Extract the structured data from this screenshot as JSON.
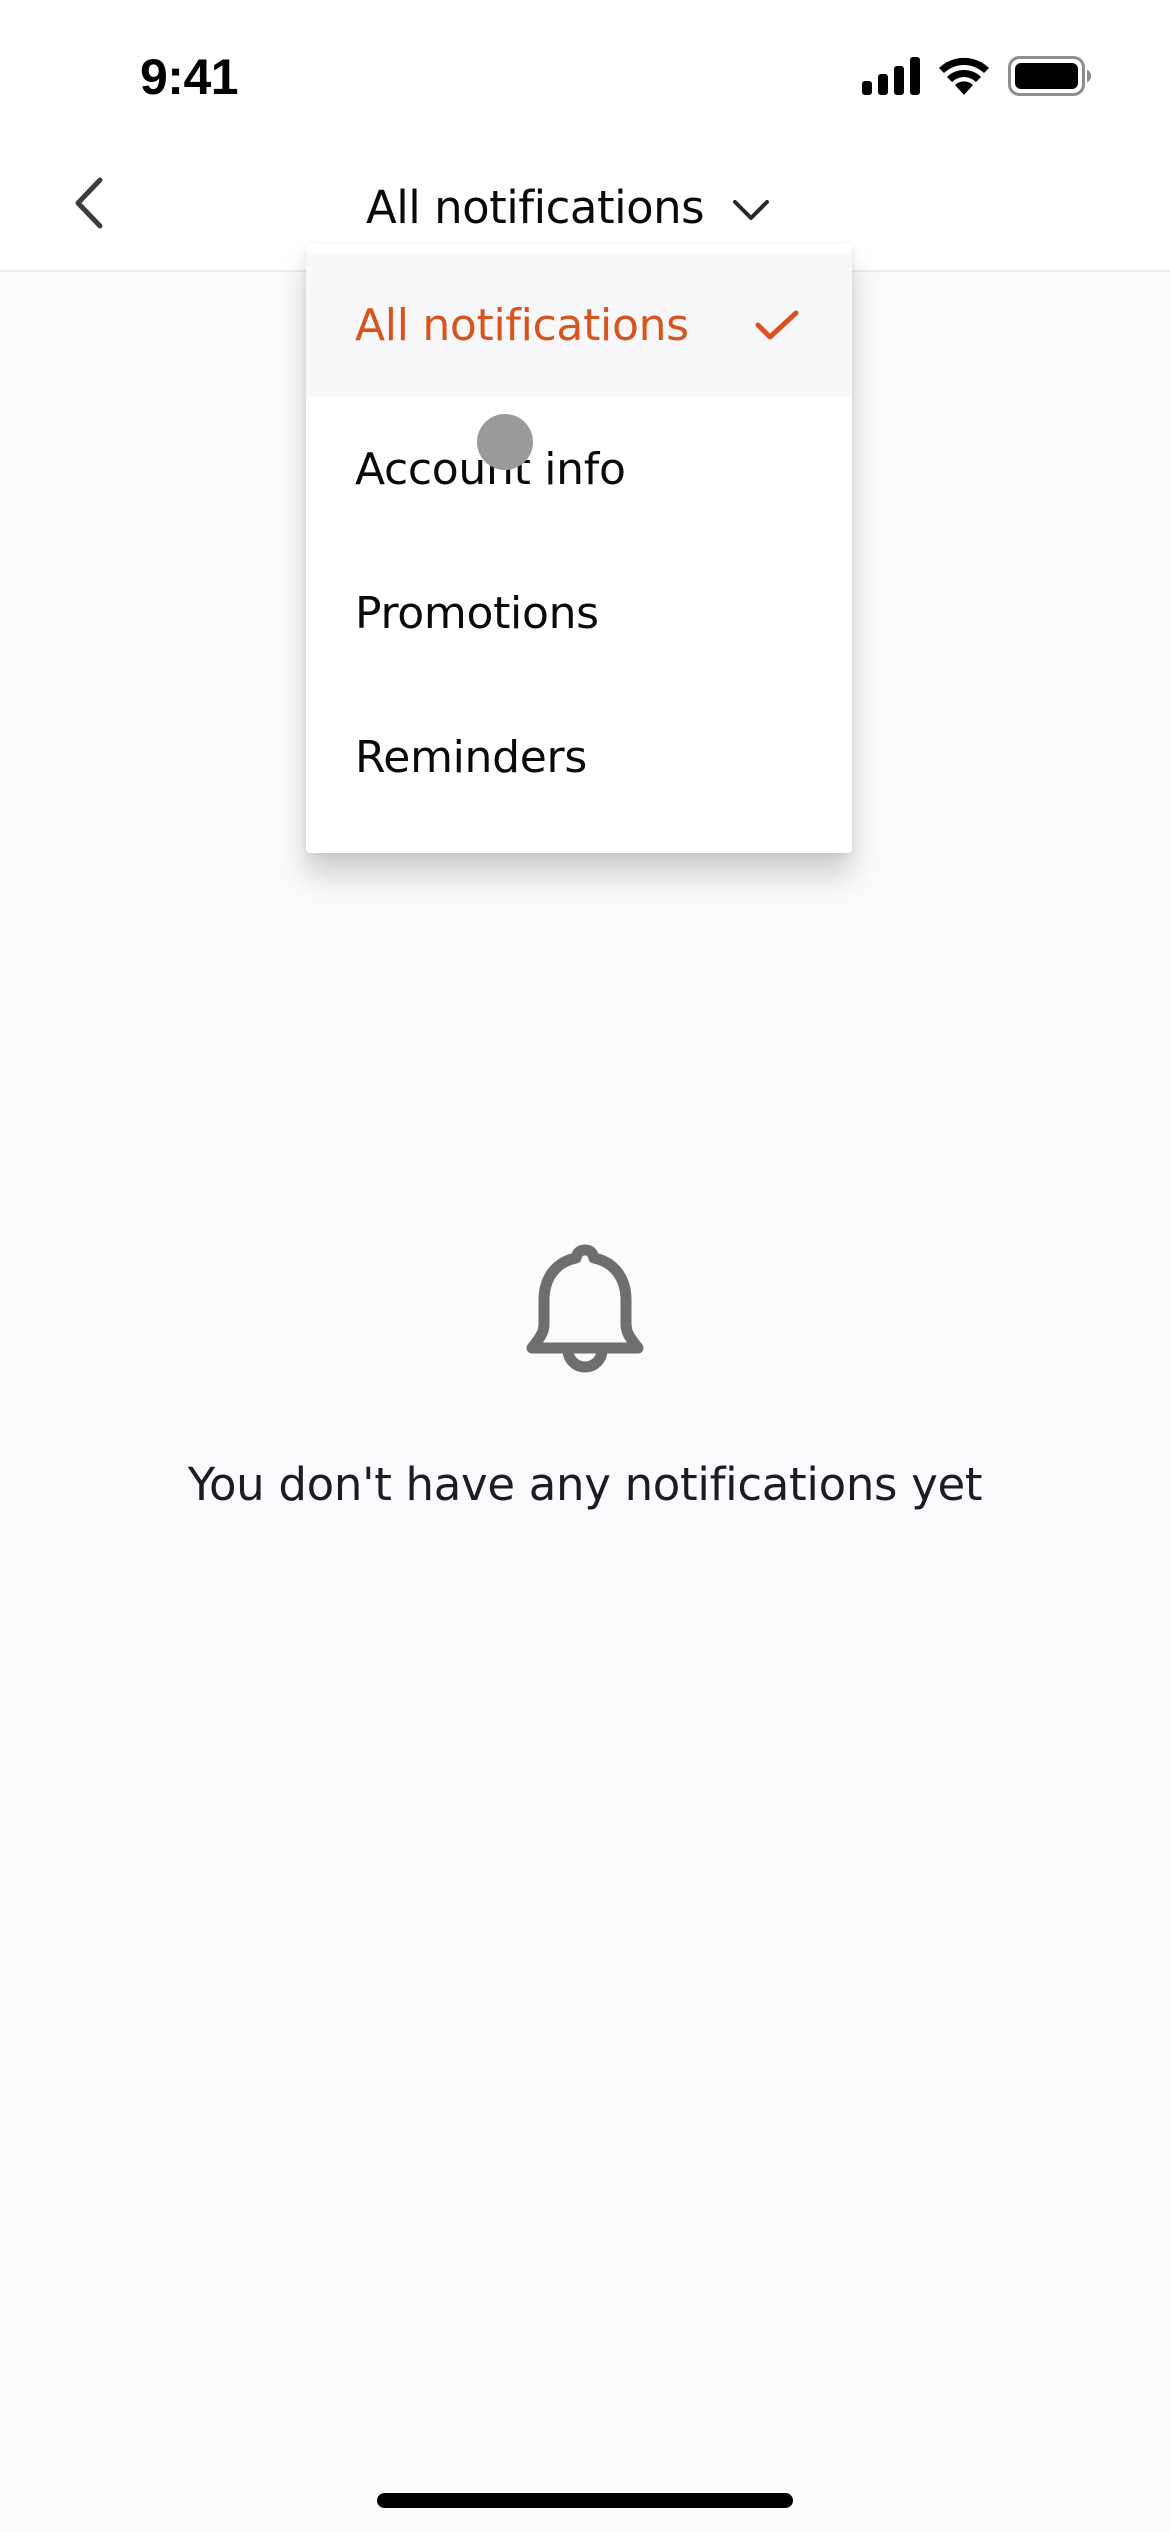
{
  "status_bar": {
    "time": "9:41",
    "icons": [
      "cellular-signal-icon",
      "wifi-icon",
      "battery-icon"
    ]
  },
  "header": {
    "back_icon": "chevron-left-icon",
    "title": "All notifications",
    "dropdown_icon": "chevron-down-icon"
  },
  "dropdown": {
    "selected": "All notifications",
    "items": [
      {
        "label": "All notifications",
        "selected": true,
        "icon": "checkmark-icon"
      },
      {
        "label": "Account info",
        "selected": false
      },
      {
        "label": "Promotions",
        "selected": false
      },
      {
        "label": "Reminders",
        "selected": false
      }
    ]
  },
  "empty_state": {
    "icon": "bell-icon",
    "message": "You don't have any notifications yet"
  },
  "colors": {
    "accent": "#D9531E",
    "background": "#FBFAFC",
    "surface": "#FFFFFF",
    "selected_row": "#F8F7F9",
    "icon_gray": "#6E6D70",
    "text": "#0A0A0A"
  }
}
